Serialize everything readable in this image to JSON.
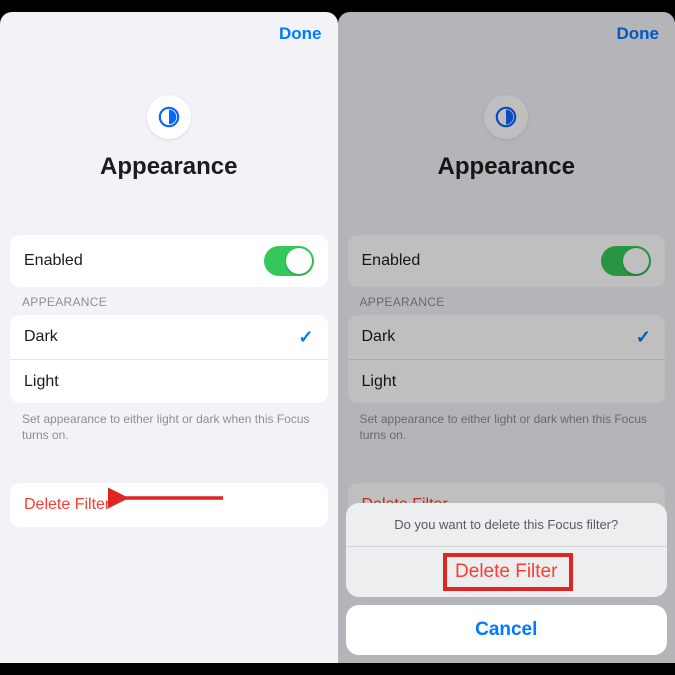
{
  "header": {
    "done": "Done"
  },
  "main": {
    "title": "Appearance",
    "enabled_label": "Enabled",
    "enabled_value": true,
    "section_header": "APPEARANCE",
    "options": {
      "dark": "Dark",
      "light": "Light",
      "selected": "dark"
    },
    "footer": "Set appearance to either light or dark when this Focus turns on.",
    "delete_label": "Delete Filter"
  },
  "sheet": {
    "prompt": "Do you want to delete this Focus filter?",
    "destructive": "Delete Filter",
    "cancel": "Cancel"
  },
  "icon_name": "appearance-icon"
}
